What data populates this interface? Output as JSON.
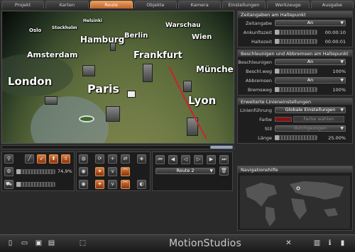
{
  "tabs": [
    "Projekt",
    "Karten",
    "Route",
    "Objekte",
    "Kamera",
    "Einstellungen",
    "Werkzeuge",
    "Ausgabe"
  ],
  "active_tab": "Route",
  "cities": [
    "Oslo",
    "Stockholm",
    "Helsinki",
    "Hamburg",
    "Berlin",
    "Warschau",
    "Wien",
    "Amsterdam",
    "Frankfurt",
    "München",
    "London",
    "Paris",
    "Lyon"
  ],
  "panel1": {
    "title": "Zeitangaben am Haltepunkt",
    "zeitangabe_label": "Zeitangabe",
    "zeitangabe_value": "An",
    "ankunft_label": "Ankunftszeit",
    "ankunft_value": "00:00:10",
    "halte_label": "Haltezeit",
    "halte_value": "00:00:01"
  },
  "panel2": {
    "title": "Beschleunigen und Abbremsen am Haltepunkt",
    "beschl_label": "Beschleunigen",
    "beschl_value": "An",
    "beschlweg_label": "Beschl.weg",
    "beschlweg_value": "100%",
    "abbremsen_label": "Abbremsen",
    "abbremsen_value": "An",
    "bremsweg_label": "Bremsweg",
    "bremsweg_value": "100%"
  },
  "panel3": {
    "title": "Erweiterte Linieneinstellungen",
    "linien_label": "Linienführung",
    "linien_value": "Globale Einstellungen",
    "farbe_label": "Farbe",
    "farbe_button": "Farbe wählen",
    "farbe_color": "#8a1010",
    "stil_label": "Stil",
    "stil_value": "durchgezogen",
    "laenge_label": "Länge",
    "laenge_value": "25.00%"
  },
  "tools": {
    "percent": "74,9%"
  },
  "route": {
    "selected": "Route 2"
  },
  "nav": {
    "title": "Navigationshilfe"
  },
  "footer": {
    "brand": "MotionStudios"
  },
  "colors": {
    "accent": "#d47a3a",
    "panel_bg": "#1e1e1e"
  }
}
